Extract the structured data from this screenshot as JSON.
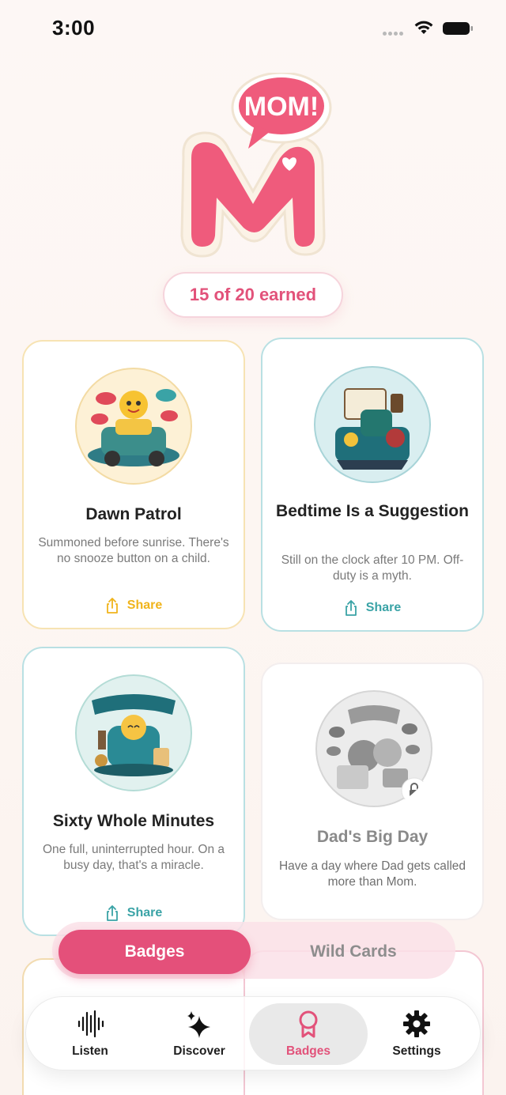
{
  "status": {
    "time": "3:00"
  },
  "header": {
    "earned_label": "15 of 20 earned",
    "logo_text": "MOM!"
  },
  "badges": [
    {
      "title": "Dawn Patrol",
      "desc": "Summoned before sunrise. There's no snooze button on a child.",
      "share": "Share",
      "state": "earned"
    },
    {
      "title": "Bedtime Is a Suggestion",
      "desc": "Still on the clock after 10 PM. Off-duty is a myth.",
      "share": "Share",
      "state": "earned"
    },
    {
      "title": "Sixty Whole Minutes",
      "desc": "One full, uninterrupted hour. On a busy day, that's a miracle.",
      "share": "Share",
      "state": "earned"
    },
    {
      "title": "Dad's Big Day",
      "desc": "Have a day where Dad gets called more than Mom.",
      "state": "locked"
    }
  ],
  "segmented": {
    "badges_label": "Badges",
    "wild_cards_label": "Wild Cards",
    "selected": "Badges"
  },
  "tabs": [
    {
      "label": "Listen",
      "icon": "waveform-icon"
    },
    {
      "label": "Discover",
      "icon": "sparkles-icon"
    },
    {
      "label": "Badges",
      "icon": "ribbon-badge-icon"
    },
    {
      "label": "Settings",
      "icon": "gear-icon"
    }
  ],
  "active_tab": "Badges",
  "colors": {
    "accent": "#e4507a",
    "share_yellow": "#f0b41c",
    "share_teal": "#3aa3a6"
  }
}
